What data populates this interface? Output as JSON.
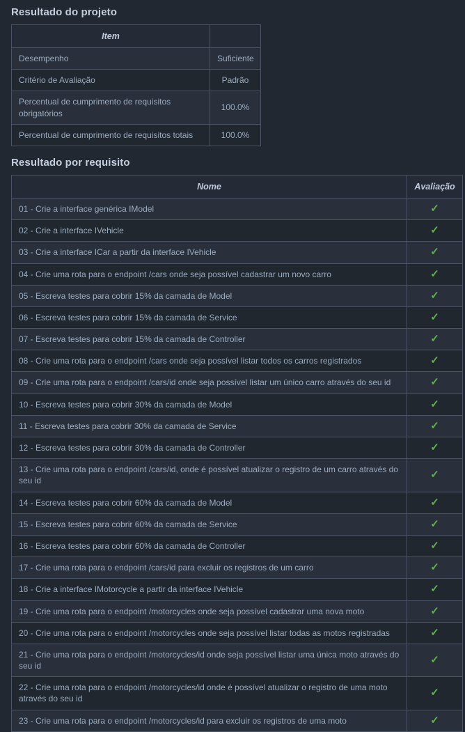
{
  "summary": {
    "title": "Resultado do projeto",
    "headers": [
      "Item",
      ""
    ],
    "rows": [
      {
        "item": "Desempenho",
        "value": "Suficiente"
      },
      {
        "item": "Critério de Avaliação",
        "value": "Padrão"
      },
      {
        "item": "Percentual de cumprimento de requisitos obrigatórios",
        "value": "100.0%"
      },
      {
        "item": "Percentual de cumprimento de requisitos totais",
        "value": "100.0%"
      }
    ]
  },
  "requirements": {
    "title": "Resultado por requisito",
    "headers": [
      "Nome",
      "Avaliação"
    ],
    "icons": {
      "pass": "✓",
      "fail": "✗"
    },
    "rows": [
      {
        "name": "01 - Crie a interface genérica IModel",
        "status": "✓"
      },
      {
        "name": "02 - Crie a interface IVehicle",
        "status": "✓"
      },
      {
        "name": "03 - Crie a interface ICar a partir da interface IVehicle",
        "status": "✓"
      },
      {
        "name": "04 - Crie uma rota para o endpoint /cars onde seja possível cadastrar um novo carro",
        "status": "✓"
      },
      {
        "name": "05 - Escreva testes para cobrir 15% da camada de Model",
        "status": "✓"
      },
      {
        "name": "06 - Escreva testes para cobrir 15% da camada de Service",
        "status": "✓"
      },
      {
        "name": "07 - Escreva testes para cobrir 15% da camada de Controller",
        "status": "✓"
      },
      {
        "name": "08 - Crie uma rota para o endpoint /cars onde seja possível listar todos os carros registrados",
        "status": "✓"
      },
      {
        "name": "09 - Crie uma rota para o endpoint /cars/id onde seja possível listar um único carro através do seu id",
        "status": "✓"
      },
      {
        "name": "10 - Escreva testes para cobrir 30% da camada de Model",
        "status": "✓"
      },
      {
        "name": "11 - Escreva testes para cobrir 30% da camada de Service",
        "status": "✓"
      },
      {
        "name": "12 - Escreva testes para cobrir 30% da camada de Controller",
        "status": "✓"
      },
      {
        "name": "13 - Crie uma rota para o endpoint /cars/id, onde é possível atualizar o registro de um carro através do seu id",
        "status": "✓"
      },
      {
        "name": "14 - Escreva testes para cobrir 60% da camada de Model",
        "status": "✓"
      },
      {
        "name": "15 - Escreva testes para cobrir 60% da camada de Service",
        "status": "✓"
      },
      {
        "name": "16 - Escreva testes para cobrir 60% da camada de Controller",
        "status": "✓"
      },
      {
        "name": "17 - Crie uma rota para o endpoint /cars/id para excluir os registros de um carro",
        "status": "✓"
      },
      {
        "name": "18 - Crie a interface IMotorcycle a partir da interface IVehicle",
        "status": "✓"
      },
      {
        "name": "19 - Crie uma rota para o endpoint /motorcycles onde seja possível cadastrar uma nova moto",
        "status": "✓"
      },
      {
        "name": "20 - Crie uma rota para o endpoint /motorcycles onde seja possível listar todas as motos registradas",
        "status": "✓"
      },
      {
        "name": "21 - Crie uma rota para o endpoint /motorcycles/id onde seja possível listar uma única moto através do seu id",
        "status": "✓"
      },
      {
        "name": "22 - Crie uma rota para o endpoint /motorcycles/id onde é possível atualizar o registro de uma moto através do seu id",
        "status": "✓"
      },
      {
        "name": "23 - Crie uma rota para o endpoint /motorcycles/id para excluir os registros de uma moto",
        "status": "✓"
      }
    ]
  },
  "theme": {
    "background": "#222831",
    "border": "#4a5465",
    "text": "#9aabbf",
    "heading": "#c3cedd",
    "row_odd": "#2a303b",
    "row_even": "#21272f",
    "header_bg": "#252b36",
    "pass_color": "#60b24a"
  }
}
